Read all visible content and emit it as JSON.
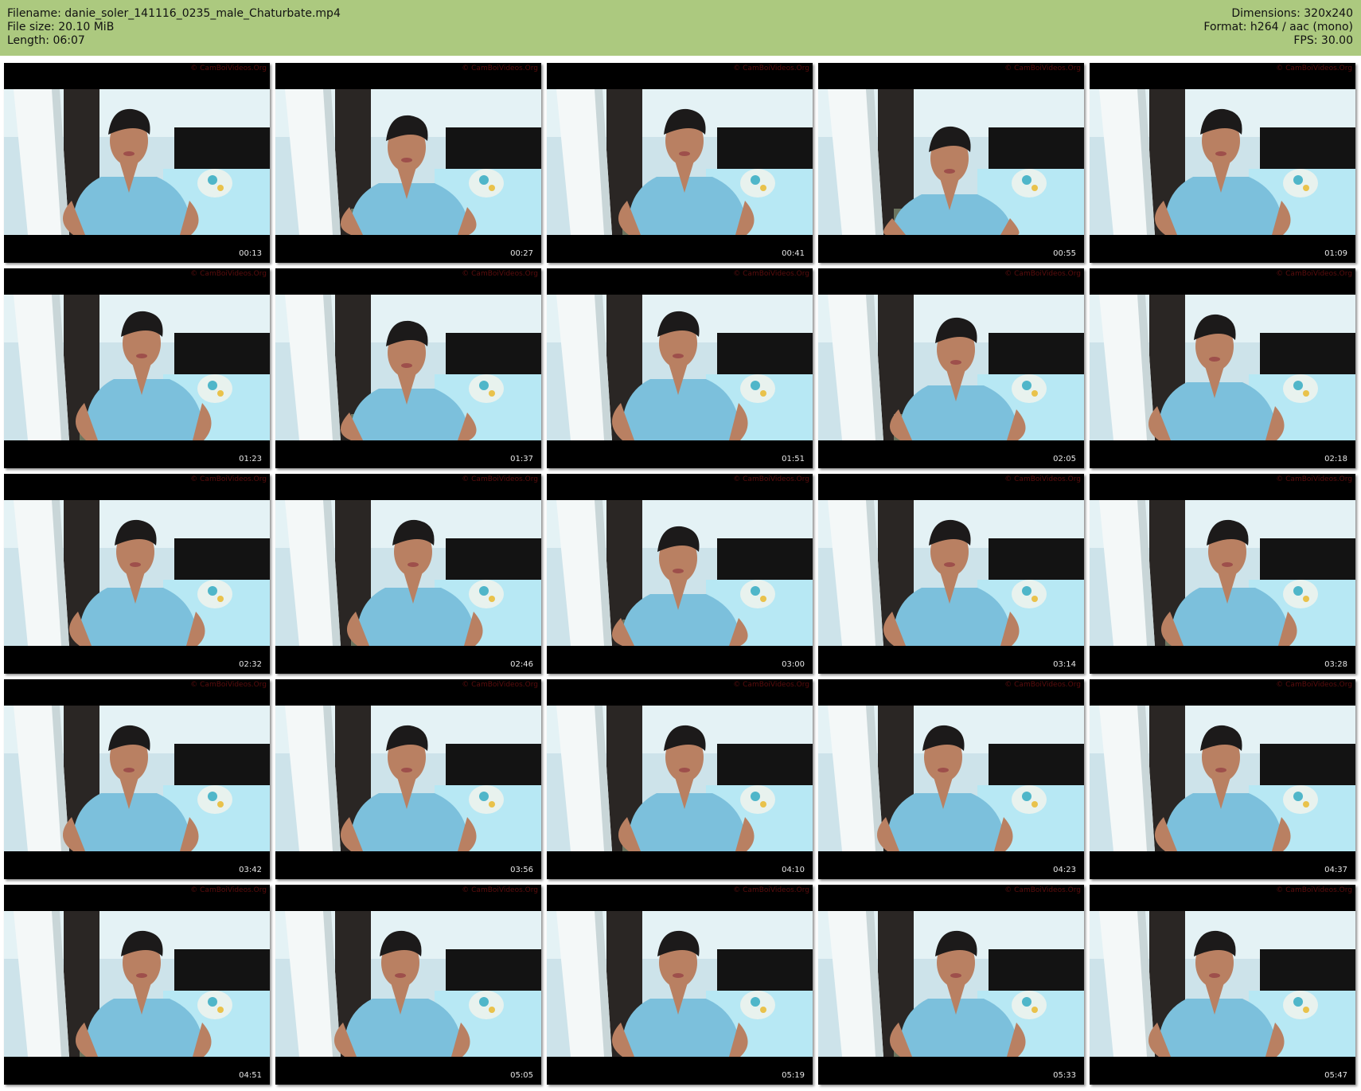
{
  "header": {
    "filename": "Filename: danie_soler_141116_0235_male_Chaturbate.mp4",
    "filesize": "File size: 20.10 MiB",
    "length": "Length: 06:07",
    "dimensions": "Dimensions: 320x240",
    "format": "Format: h264 / aac (mono)",
    "fps": "FPS: 30.00"
  },
  "colors": {
    "header_bg": "#acc97f",
    "wall": "#cde3ea",
    "shirt": "#7cc0dc",
    "skin": "#b98062",
    "hair": "#1c1a1a",
    "bed": "#131313",
    "sheet": "#b7e8f4"
  },
  "watermark": "© CamBoiVideos.Org",
  "thumbnails": [
    {
      "time": "00:13",
      "pose": "tongue"
    },
    {
      "time": "00:27",
      "pose": "down"
    },
    {
      "time": "00:41",
      "pose": "tongue"
    },
    {
      "time": "00:55",
      "pose": "head-down"
    },
    {
      "time": "01:09",
      "pose": "front"
    },
    {
      "time": "01:23",
      "pose": "tilt"
    },
    {
      "time": "01:37",
      "pose": "down"
    },
    {
      "time": "01:51",
      "pose": "tilt"
    },
    {
      "time": "02:05",
      "pose": "bite"
    },
    {
      "time": "02:18",
      "pose": "front"
    },
    {
      "time": "02:32",
      "pose": "front"
    },
    {
      "time": "02:46",
      "pose": "front"
    },
    {
      "time": "03:00",
      "pose": "down"
    },
    {
      "time": "03:14",
      "pose": "front"
    },
    {
      "time": "03:28",
      "pose": "front"
    },
    {
      "time": "03:42",
      "pose": "front"
    },
    {
      "time": "03:56",
      "pose": "front"
    },
    {
      "time": "04:10",
      "pose": "front"
    },
    {
      "time": "04:23",
      "pose": "front"
    },
    {
      "time": "04:37",
      "pose": "front"
    },
    {
      "time": "04:51",
      "pose": "front"
    },
    {
      "time": "05:05",
      "pose": "front"
    },
    {
      "time": "05:19",
      "pose": "front"
    },
    {
      "time": "05:33",
      "pose": "front"
    },
    {
      "time": "05:47",
      "pose": "front"
    }
  ]
}
